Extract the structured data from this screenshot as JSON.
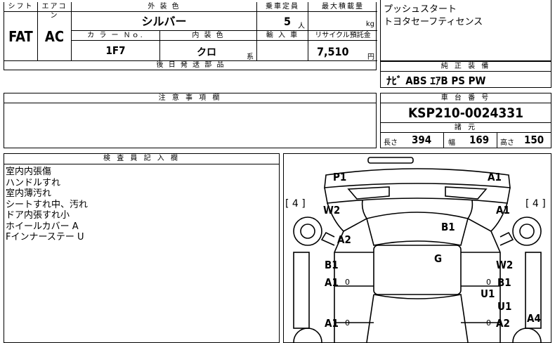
{
  "top": {
    "shift_label": "シフト",
    "aircon_label": "エアコン",
    "shift_value": "FAT",
    "aircon_value": "AC",
    "exterior_color_label": "外 装 色",
    "exterior_color_value": "シルバー",
    "capacity_label": "乗車定員",
    "capacity_value": "5",
    "capacity_unit": "人",
    "max_load_label": "最大積載量",
    "max_load_unit": "kg",
    "color_no_label": "カ ラ ー Ｎｏ.",
    "color_no_value": "1F7",
    "interior_color_label": "内 装 色",
    "interior_color_value": "クロ",
    "interior_color_suffix": "系",
    "import_label": "輸 入 車",
    "recycle_label": "リサイクル預託金",
    "recycle_value": "7,510",
    "recycle_unit": "円",
    "later_parts_label": "後 日 発 送 部 品"
  },
  "features": {
    "line1": "プッシュスタート",
    "line2": "トヨタセーフティセンス"
  },
  "equipment": {
    "label": "純 正 装 備",
    "value": "ﾅﾋﾞ ABS ｴｱB PS PW"
  },
  "notes": {
    "label": "注 意 事 項 欄"
  },
  "chassis": {
    "label": "車 台 番 号",
    "value": "KSP210-0024331",
    "spec_label": "諸 元",
    "length_label": "長さ",
    "length_value": "394",
    "width_label": "幅",
    "width_value": "169",
    "height_label": "高さ",
    "height_value": "150"
  },
  "inspector": {
    "label": "検 査 員 記 入 欄",
    "lines": [
      "室内内張傷",
      "ハンドルすれ",
      "室内薄汚れ",
      "シートすれ中、汚れ",
      "ドア内張すれ小",
      "ホイールカバー A",
      "Fインナーステー U"
    ]
  },
  "diagram": {
    "tire_left": "[ 4 ]",
    "tire_right": "[ 4 ]",
    "marks": [
      "P1",
      "A1",
      "W2",
      "A1",
      "B1",
      "A2",
      "G",
      "B1",
      "W2",
      "A1",
      "B1",
      "U1",
      "U1",
      "A1",
      "A2",
      "A4",
      "0",
      "0",
      "0",
      "0"
    ]
  }
}
